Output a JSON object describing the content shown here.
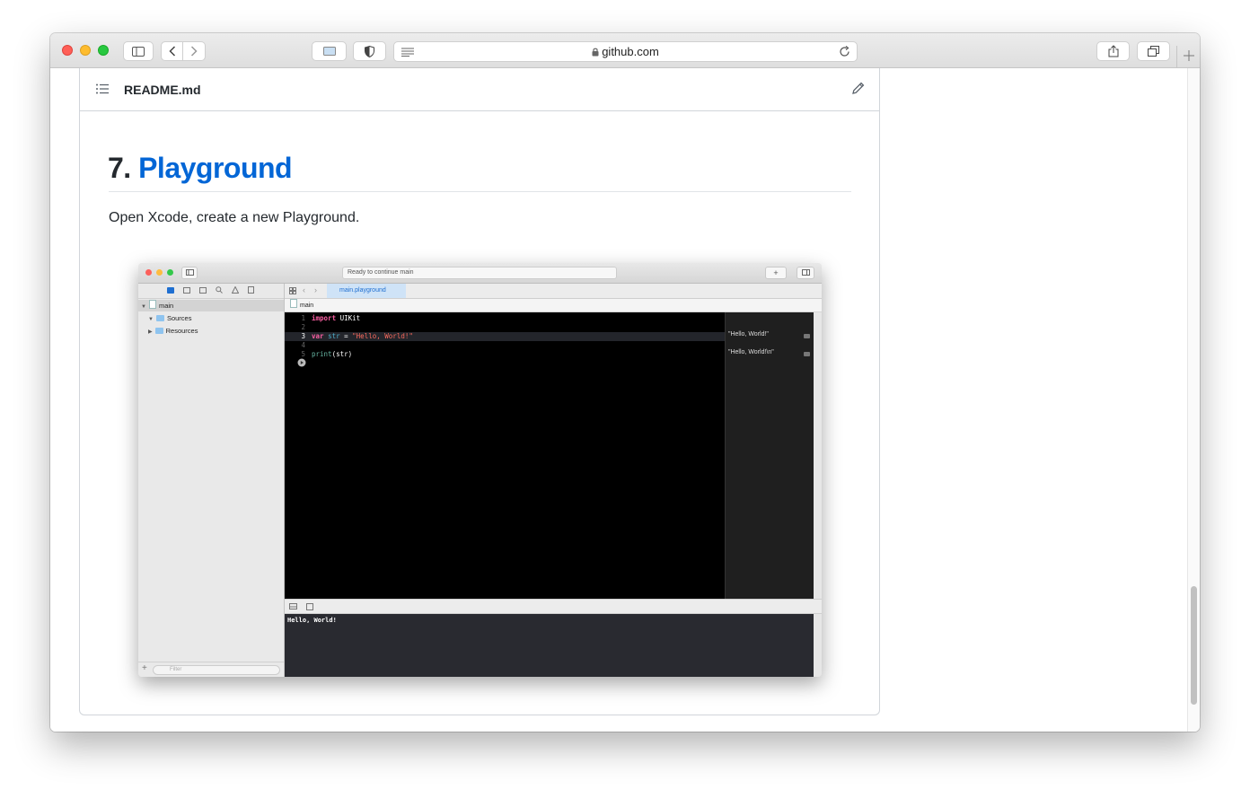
{
  "browser": {
    "url": "github.com",
    "traffic_lights": {
      "close": "#ff5f57",
      "minimize": "#febc2e",
      "zoom": "#28c840"
    }
  },
  "readme": {
    "filename": "README.md",
    "heading_number": "7.",
    "heading_link": "Playground",
    "paragraph": "Open Xcode, create a new Playground."
  },
  "xcode": {
    "status": "Ready to continue main",
    "tab_label": "main.playground",
    "jump_bar": "main",
    "navigator": [
      {
        "label": "main",
        "kind": "file",
        "expanded": true
      },
      {
        "label": "Sources",
        "kind": "folder",
        "expanded": true
      },
      {
        "label": "Resources",
        "kind": "folder",
        "expanded": false
      }
    ],
    "filter_placeholder": "Filter",
    "code_lines": [
      {
        "num": "1",
        "kw": "import",
        "rest": " UIKit"
      },
      {
        "num": "2"
      },
      {
        "num": "3",
        "kw": "var",
        "id": "str",
        "op": " = ",
        "str": "\"Hello, World!\""
      },
      {
        "num": "4"
      },
      {
        "num": "5",
        "fn": "print",
        "args": "(str)"
      }
    ],
    "results": [
      "\"Hello, World!\"",
      "\"Hello, World!\\n\""
    ],
    "console_output": "Hello, World!"
  }
}
